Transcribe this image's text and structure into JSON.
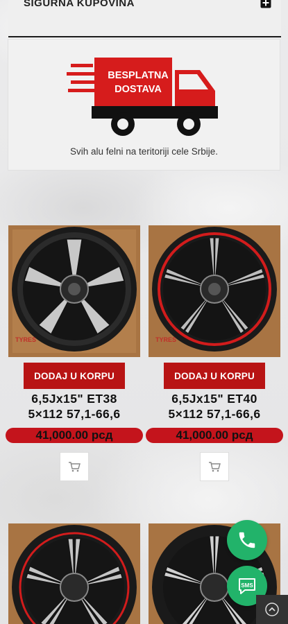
{
  "accordion": {
    "label": "SIGURNA KUPOVINA"
  },
  "promo": {
    "truck_line1": "BESPLATNA",
    "truck_line2": "DOSTAVA",
    "caption": "Svih alu felni na teritoriji cele Srbije."
  },
  "products": [
    {
      "button": "DODAJ U KORPU",
      "title_line1": "6,5Jx15\" ET38",
      "title_line2": "5×112 57,1-66,6",
      "price": "41,000.00 рсд",
      "watermark": "TYRES"
    },
    {
      "button": "DODAJ U KORPU",
      "title_line1": "6,5Jx15\" ET40",
      "title_line2": "5×112 57,1-66,6",
      "price": "41,000.00 рсд",
      "watermark": "TYRES"
    }
  ],
  "colors": {
    "accent_red": "#b81414",
    "price_red": "#c4141c",
    "fab_green": "#22b36a"
  },
  "icons": {
    "phone": "phone-icon",
    "sms": "sms-icon",
    "cart": "cart-icon",
    "plus": "plus-square-icon",
    "up": "chevron-up-icon"
  }
}
